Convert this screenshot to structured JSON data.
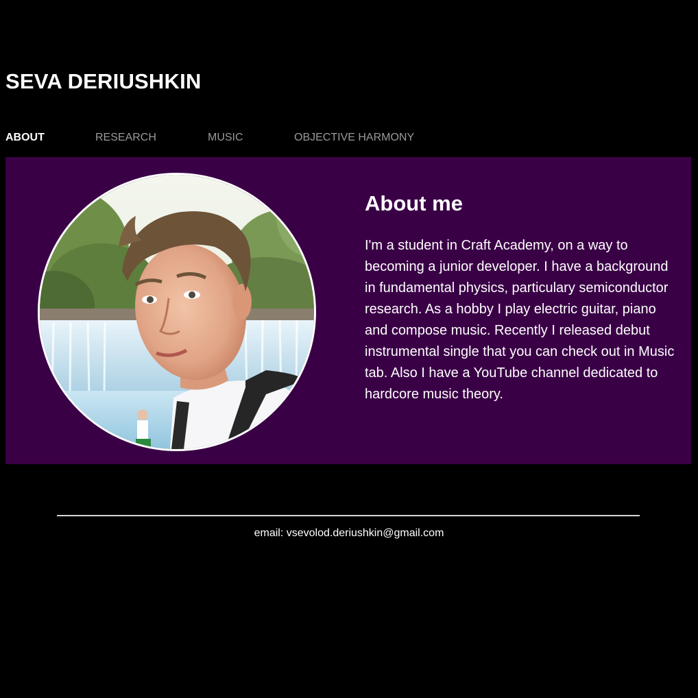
{
  "header": {
    "site_title": "SEVA DERIUSHKIN"
  },
  "nav": {
    "items": [
      {
        "label": "ABOUT",
        "active": true
      },
      {
        "label": "RESEARCH",
        "active": false
      },
      {
        "label": "MUSIC",
        "active": false
      },
      {
        "label": "OBJECTIVE HARMONY",
        "active": false
      }
    ]
  },
  "about": {
    "heading": "About me",
    "text": "I'm a student in Craft Academy, on a way to becoming a junior developer. I have a background in fundamental physics, particulary semiconductor research. As a hobby I play electric guitar, piano and compose music. Recently I released debut instrumental single that you can check out in Music tab. Also I have a YouTube channel dedicated to hardcore music theory.",
    "photo": "portrait-photo"
  },
  "footer": {
    "email_text": "email: vsevolod.deriushkin@gmail.com"
  },
  "colors": {
    "background": "#000000",
    "panel": "#3a0046",
    "nav_active": "#ffffff",
    "nav_inactive": "#9a9a9a",
    "text": "#ffffff"
  }
}
